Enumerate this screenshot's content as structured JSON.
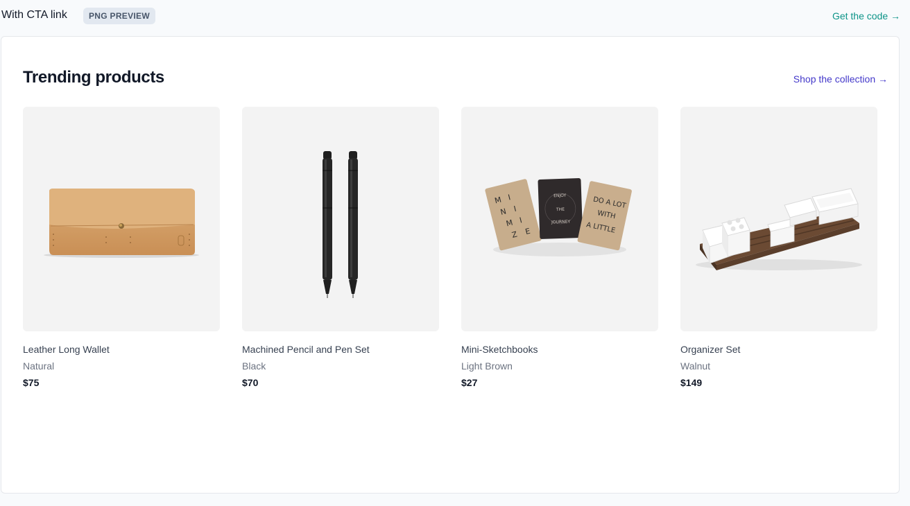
{
  "header": {
    "title": "With CTA link",
    "badge": "PNG PREVIEW",
    "code_link": "Get the code →"
  },
  "section": {
    "title": "Trending products",
    "cta": "Shop the collection →"
  },
  "products": [
    {
      "name": "Leather Long Wallet",
      "color": "Natural",
      "price": "$75",
      "image": "wallet-image"
    },
    {
      "name": "Machined Pencil and Pen Set",
      "color": "Black",
      "price": "$70",
      "image": "pencil-pen-image"
    },
    {
      "name": "Mini-Sketchbooks",
      "color": "Light Brown",
      "price": "$27",
      "image": "sketchbooks-image"
    },
    {
      "name": "Organizer Set",
      "color": "Walnut",
      "price": "$149",
      "image": "organizer-image"
    }
  ],
  "sketchbook_covers": {
    "left": "MINIMIZE",
    "middle": "ENJOY THE JOURNEY",
    "right": [
      "DO A LOT",
      "WITH",
      "A LITTLE"
    ]
  },
  "colors": {
    "teal_link": "#0d9488",
    "indigo_link": "#4338ca",
    "image_bg": "#f3f3f3",
    "leather": "#d6a56e",
    "walnut": "#6b4a33"
  }
}
